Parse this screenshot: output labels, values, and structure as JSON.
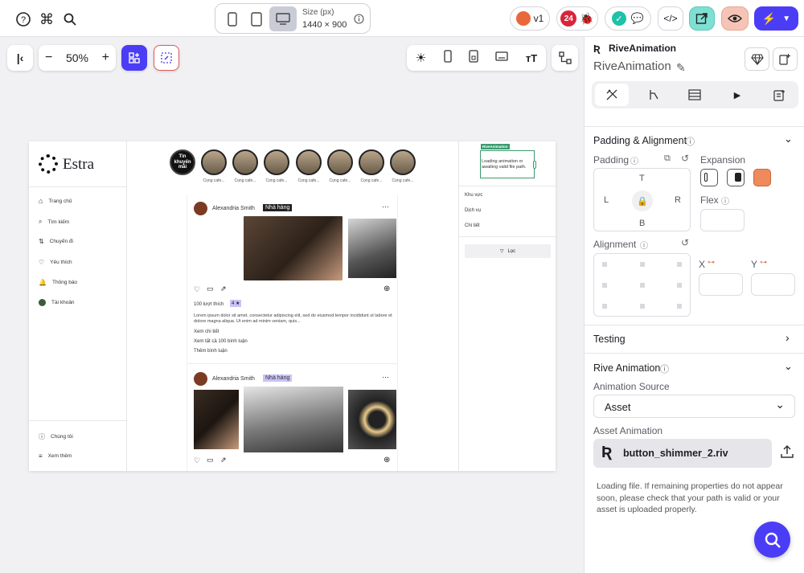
{
  "topbar": {
    "size_label": "Size (px)",
    "size_value": "1440 × 900",
    "version": "v1",
    "notifications": "24"
  },
  "canvas_toolbar": {
    "zoom": "50%"
  },
  "mock": {
    "brand": "Estra",
    "nav": [
      "Trang chủ",
      "Tìm kiếm",
      "Chuyến đi",
      "Yêu thích",
      "Thông báo",
      "Tài khoản"
    ],
    "nav_bottom": [
      "Chúng tôi",
      "Xem thêm"
    ],
    "story_first": "Tin khuyến mãi",
    "story_label": "Cọng cafe...",
    "post1": {
      "author": "Alexandria Smith",
      "tag": "Nhà hàng",
      "likes": "100 lượt thích",
      "rating": "4 ★",
      "text": "Lorem ipsum dolor sit amet, consectetur adipiscing elit, sed do eiusmod tempor incididunt ut labore et dolore magna aliqua. Ut enim ad minim veniam, quis...",
      "detail": "Xem chi tiết",
      "comments": "Xem tất cả 100 bình luận",
      "add_comment": "Thêm bình luận"
    },
    "post2": {
      "author": "Alexandria Smith",
      "tag": "Nhà hàng"
    },
    "right_panel": {
      "rive_badge": "RiveAnimation",
      "rive_text": "Loading animation or awaiting valid file path.",
      "links": [
        "Khu vực",
        "Dịch vụ",
        "Chi tiết"
      ],
      "filter": "Lọc"
    }
  },
  "panel": {
    "component_type": "RiveAnimation",
    "component_name": "RiveAnimation",
    "padding_alignment": "Padding & Alignment",
    "padding": "Padding",
    "expansion": "Expansion",
    "pad_t": "T",
    "pad_l": "L",
    "pad_r": "R",
    "pad_b": "B",
    "flex": "Flex",
    "alignment": "Alignment",
    "x": "X",
    "y": "Y",
    "testing": "Testing",
    "rive_animation": "Rive Animation",
    "animation_source": "Animation Source",
    "source_value": "Asset",
    "asset_animation": "Asset Animation",
    "file_name": "button_shimmer_2.riv",
    "loading_note": "Loading file. If remaining properties do not appear soon, please check that your path is valid or your asset is uploaded properly."
  },
  "colors": {
    "accent": "#4b3df5",
    "expansion_active": "#ee8a5c",
    "preview_active": "#f6c4b6",
    "share_active": "#7ee0d2",
    "rive_green": "#3a9a6f"
  }
}
